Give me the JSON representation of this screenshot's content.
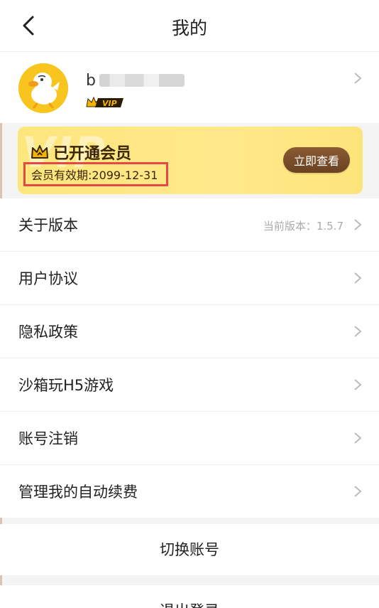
{
  "header": {
    "title": "我的"
  },
  "profile": {
    "username_visible": "b",
    "vip_label": "VIP"
  },
  "membership": {
    "title": "已开通会员",
    "expiry": "会员有效期:2099-12-31",
    "button": "立即查看",
    "watermark": "VIP"
  },
  "menu": {
    "items": [
      {
        "label": "关于版本",
        "value": "当前版本：1.5.7"
      },
      {
        "label": "用户协议",
        "value": ""
      },
      {
        "label": "隐私政策",
        "value": ""
      },
      {
        "label": "沙箱玩H5游戏",
        "value": ""
      },
      {
        "label": "账号注销",
        "value": ""
      },
      {
        "label": "管理我的自动续费",
        "value": ""
      }
    ]
  },
  "actions": {
    "switch_account": "切换账号",
    "logout": "退出登录"
  },
  "colors": {
    "accent_gold": "#fde67c",
    "button_brown": "#6a4222",
    "highlight_red": "#e64646"
  }
}
